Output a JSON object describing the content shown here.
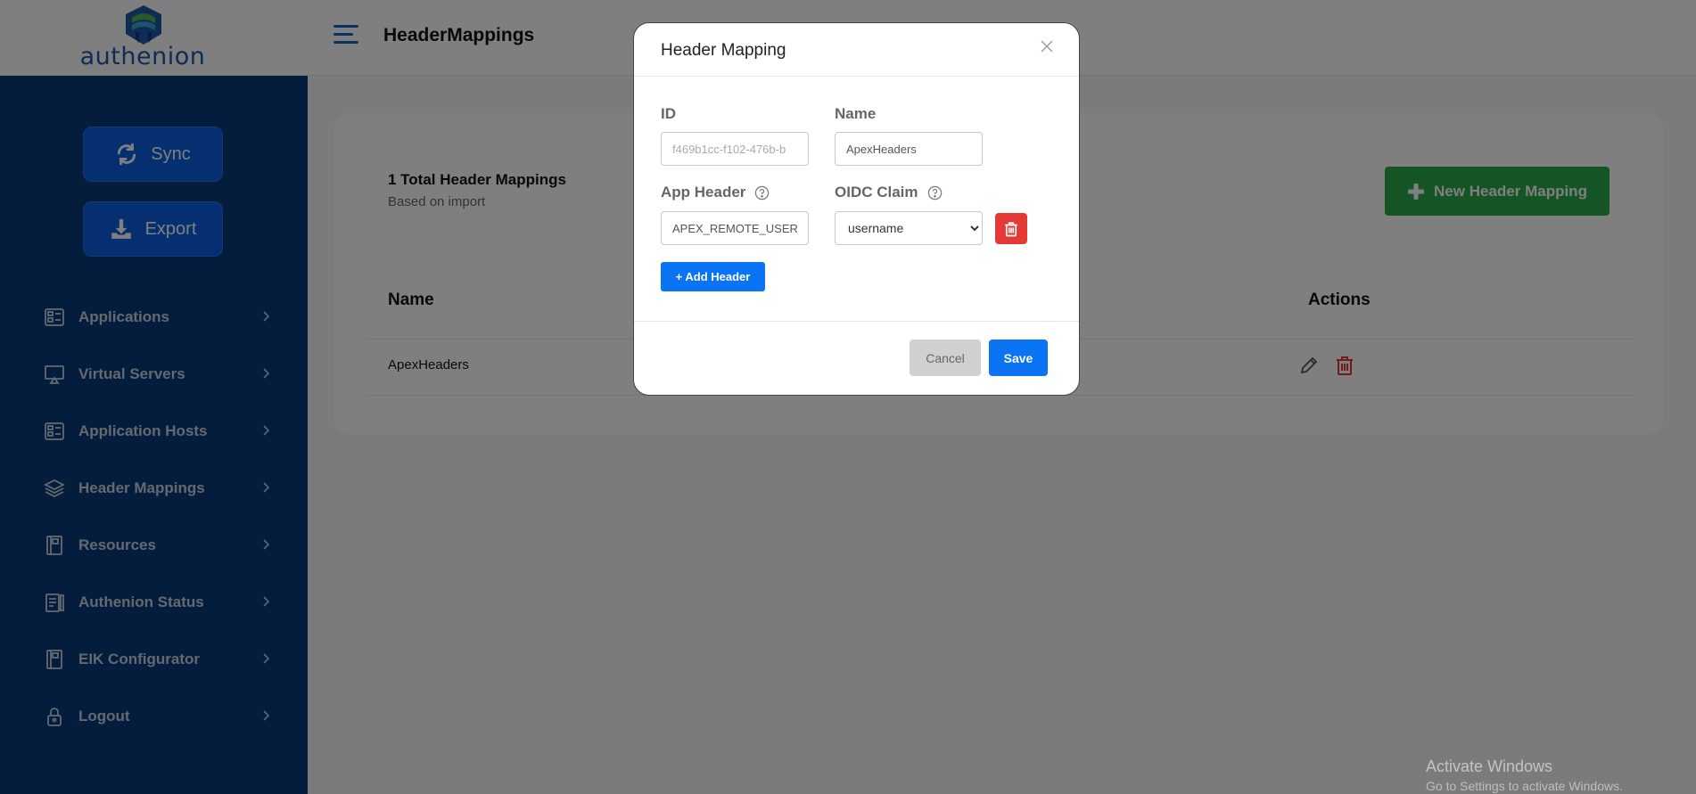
{
  "brand": {
    "name": "authenion"
  },
  "header": {
    "title": "HeaderMappings"
  },
  "sidebar": {
    "sync_label": "Sync",
    "export_label": "Export",
    "items": [
      {
        "label": "Applications",
        "icon": "applications-icon"
      },
      {
        "label": "Virtual Servers",
        "icon": "monitor-icon"
      },
      {
        "label": "Application Hosts",
        "icon": "server-icon"
      },
      {
        "label": "Header Mappings",
        "icon": "layers-icon"
      },
      {
        "label": "Resources",
        "icon": "book-icon"
      },
      {
        "label": "Authenion Status",
        "icon": "clipboard-icon"
      },
      {
        "label": "EIK Configurator",
        "icon": "book-icon"
      },
      {
        "label": "Logout",
        "icon": "lock-icon"
      }
    ]
  },
  "main": {
    "total_label": "1 Total Header Mappings",
    "subtitle": "Based on import",
    "new_button": "New Header Mapping",
    "columns": [
      "Name",
      "Actions"
    ],
    "rows": [
      {
        "name": "ApexHeaders"
      }
    ]
  },
  "modal": {
    "title": "Header Mapping",
    "id_label": "ID",
    "id_value": "f469b1cc-f102-476b-b",
    "name_label": "Name",
    "name_value": "ApexHeaders",
    "app_header_label": "App Header",
    "app_header_value": "APEX_REMOTE_USER",
    "oidc_claim_label": "OIDC Claim",
    "oidc_claim_value": "username",
    "add_header_label": "+ Add Header",
    "cancel_label": "Cancel",
    "save_label": "Save"
  },
  "watermark": {
    "line1": "Activate Windows",
    "line2": "Go to Settings to activate Windows."
  },
  "colors": {
    "sidebar_bg": "#0b3a78",
    "primary": "#0a74f5",
    "success": "#2aa84a",
    "danger": "#e53935"
  }
}
